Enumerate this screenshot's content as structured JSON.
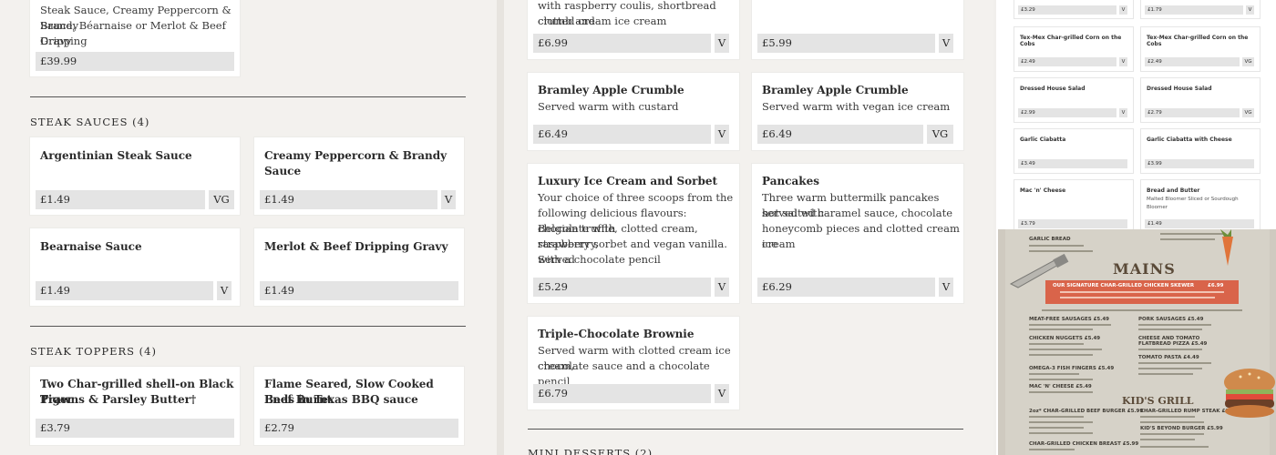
{
  "col1": {
    "top_card": {
      "desc_lines": [
        "Steak Sauce, Creamy Peppercorn & Brandy",
        "Sauce, Béarnaise or Merlot & Beef Dripping",
        "Gravy"
      ],
      "price": "£39.99"
    },
    "steak_sauces": {
      "title": "STEAK SAUCES (4)",
      "items": [
        {
          "name": "Argentinian Steak Sauce",
          "price": "£1.49",
          "tag": "VG"
        },
        {
          "name": "Creamy Peppercorn & Brandy Sauce",
          "price": "£1.49",
          "tag": "V"
        },
        {
          "name": "Bearnaise Sauce",
          "price": "£1.49",
          "tag": "V"
        },
        {
          "name": "Merlot & Beef Dripping Gravy",
          "price": "£1.49",
          "tag": ""
        }
      ]
    },
    "steak_toppers": {
      "title": "STEAK TOPPERS (4)",
      "items": [
        {
          "name_lines": [
            "Two Char-grilled shell-on Black Tiger",
            "Prawns & Parsley Butter†"
          ],
          "price": "£3.79"
        },
        {
          "name_lines": [
            "Flame Seared, Slow Cooked Beef Burnt",
            "Ends in Texas BBQ sauce"
          ],
          "price": "£2.79"
        }
      ]
    }
  },
  "col2": {
    "top_left": {
      "desc_lines": [
        "with raspberry coulis, shortbread crumb and",
        "clotted cream ice cream"
      ],
      "price": "£6.99",
      "tag": "V"
    },
    "top_right": {
      "price": "£5.99",
      "tag": "V"
    },
    "items": [
      {
        "name": "Bramley Apple Crumble",
        "desc_lines": [
          "Served warm with custard"
        ],
        "price": "£6.49",
        "tag": "V"
      },
      {
        "name": "Bramley Apple Crumble",
        "desc_lines": [
          "Served warm with vegan ice cream"
        ],
        "price": "£6.49",
        "tag": "VG"
      },
      {
        "name": "Luxury Ice Cream and Sorbet",
        "desc_lines": [
          "Your choice of three scoops from the",
          "following delicious flavours: chocolate with",
          "Belgian truffle, clotted cream, strawberry,",
          "raspberry sorbet and vegan vanilla. Served",
          "with a chocolate pencil"
        ],
        "price": "£5.29",
        "tag": "V"
      },
      {
        "name": "Pancakes",
        "desc_lines": [
          "Three warm buttermilk pancakes served with",
          "hot salted caramel sauce, chocolate",
          "honeycomb pieces and clotted cream ice",
          "cream"
        ],
        "price": "£6.29",
        "tag": "V"
      },
      {
        "name": "Triple-Chocolate Brownie",
        "desc_lines": [
          "Served warm with clotted cream ice cream,",
          "chocolate sauce and a chocolate pencil"
        ],
        "price": "£6.79",
        "tag": "V"
      }
    ],
    "mini_desserts_title": "MINI DESSERTS (2)"
  },
  "col3": {
    "rows": [
      {
        "left": {
          "name": "",
          "price": "£3.29",
          "tag": "V"
        },
        "right": {
          "name": "",
          "price": "£1.79",
          "tag": "V"
        }
      },
      {
        "left": {
          "name": "Tex-Mex Char-grilled Corn on the Cobs",
          "price": "£2.49",
          "tag": "V"
        },
        "right": {
          "name": "Tex-Mex Char-grilled Corn on the Cobs",
          "price": "£2.49",
          "tag": "VG"
        }
      },
      {
        "left": {
          "name": "Dressed House Salad",
          "price": "£2.99",
          "tag": "V"
        },
        "right": {
          "name": "Dressed House Salad",
          "price": "£2.79",
          "tag": "VG"
        }
      },
      {
        "left": {
          "name": "Garlic Ciabatta",
          "price": "£3.49",
          "tag": ""
        },
        "right": {
          "name": "Garlic Ciabatta with Cheese",
          "price": "£3.99",
          "tag": ""
        }
      },
      {
        "left": {
          "name": "Mac 'n' Cheese",
          "price": "£3.79",
          "tag": ""
        },
        "right": {
          "name": "Bread and Butter",
          "desc_lines": [
            "Malted Bloomer Sliced or Sourdough",
            "Bloomer"
          ],
          "price": "£1.49",
          "tag": ""
        }
      }
    ]
  },
  "photo": {
    "heading": "MAINS",
    "banner": "OUR SIGNATURE CHAR-GRILLED CHICKEN SKEWER",
    "banner_price": "£6.99",
    "items_left": [
      "MEAT-FREE SAUSAGES £5.49",
      "CHICKEN NUGGETS £5.49",
      "OMEGA-3 FISH FINGERS £5.49",
      "MAC 'N' CHEESE £5.49"
    ],
    "items_right": [
      "PORK SAUSAGES £5.49",
      "CHEESE AND TOMATO FLATBREAD PIZZA £5.49",
      "TOMATO PASTA £4.49"
    ],
    "subheading": "KID'S GRILL",
    "grill_left": [
      "2oz* CHAR-GRILLED BEEF BURGER £5.99",
      "CHAR-GRILLED CHICKEN BREAST £5.99"
    ],
    "grill_right": [
      "CHAR-GRILLED RUMP STEAK £6.99",
      "KID'S BEYOND BURGER £5.99"
    ],
    "top_left": "GARLIC BREAD"
  }
}
